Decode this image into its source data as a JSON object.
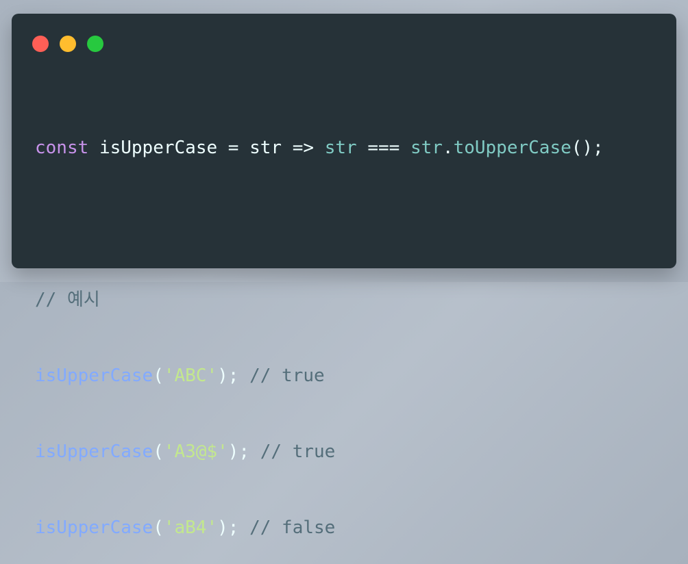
{
  "window": {
    "traffic_lights": [
      {
        "name": "close",
        "color": "#ff5f56"
      },
      {
        "name": "minimize",
        "color": "#ffbd2e"
      },
      {
        "name": "maximize",
        "color": "#27c93f"
      }
    ]
  },
  "colors": {
    "background": "#263238",
    "keyword": "#c792ea",
    "text": "#eeffff",
    "param": "#80cbc4",
    "function": "#82aaff",
    "string": "#c3e88d",
    "comment": "#546e7a"
  },
  "code": {
    "line1": {
      "kw": "const",
      "name": "isUpperCase",
      "eq": "=",
      "param": "str",
      "arrow": "=>",
      "param2": "str",
      "op": "===",
      "obj": "str",
      "dot": ".",
      "method": "toUpperCase",
      "tail": "();"
    },
    "comment": "// 예시",
    "examples": [
      {
        "fn": "isUpperCase",
        "open": "(",
        "arg": "'ABC'",
        "close": ");",
        "comment": "// true"
      },
      {
        "fn": "isUpperCase",
        "open": "(",
        "arg": "'A3@$'",
        "close": ");",
        "comment": "// true"
      },
      {
        "fn": "isUpperCase",
        "open": "(",
        "arg": "'aB4'",
        "close": ");",
        "comment": "// false"
      }
    ]
  }
}
